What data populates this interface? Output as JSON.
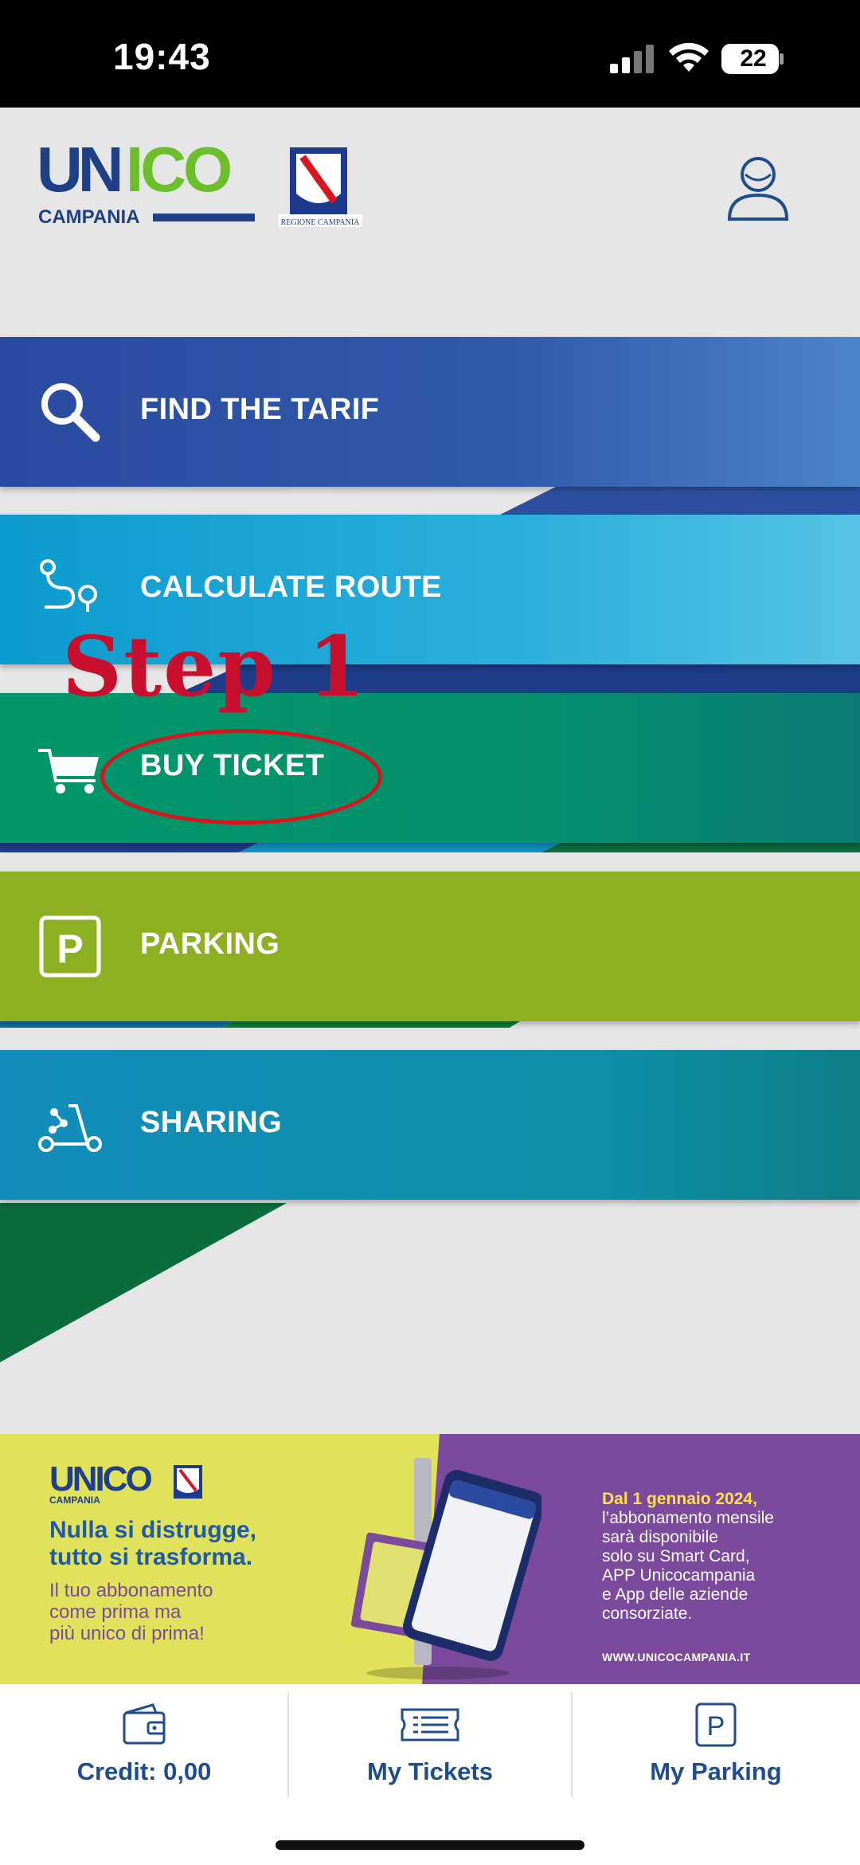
{
  "status_bar": {
    "time": "19:43",
    "battery": "22"
  },
  "header": {
    "logo_text": "UNICO",
    "logo_subtitle": "CAMPANIA",
    "region_caption": "REGIONE CAMPANIA",
    "profile_icon": "user-icon"
  },
  "menu": {
    "items": [
      {
        "label": "FIND THE TARIF",
        "icon": "search-icon"
      },
      {
        "label": "CALCULATE ROUTE",
        "icon": "route-icon"
      },
      {
        "label": "BUY TICKET",
        "icon": "cart-icon"
      },
      {
        "label": "PARKING",
        "icon": "parking-icon"
      },
      {
        "label": "SHARING",
        "icon": "scooter-icon"
      }
    ]
  },
  "annotation": {
    "step_text": "Step 1"
  },
  "banner": {
    "logo_text": "UNICO",
    "logo_subtitle": "CAMPANIA",
    "headline_1": "Nulla si distrugge,",
    "headline_2": "tutto si trasforma.",
    "sub_1": "Il tuo abbonamento",
    "sub_2": "come prima ma",
    "sub_3": "più unico di prima!",
    "right_date": "Dal 1 gennaio 2024,",
    "right_1": "l’abbonamento mensile",
    "right_2": "sarà disponibile",
    "right_3": "solo su Smart Card,",
    "right_4": "APP Unicocampania",
    "right_5": "e App delle aziende",
    "right_6": "consorziate.",
    "url": "WWW.UNICOCAMPANIA.IT"
  },
  "bottom_nav": {
    "items": [
      {
        "label": "Credit: 0,00",
        "icon": "wallet-icon"
      },
      {
        "label": "My Tickets",
        "icon": "tickets-icon"
      },
      {
        "label": "My Parking",
        "icon": "parking-icon"
      }
    ]
  },
  "colors": {
    "nav_text": "#1f4c8d",
    "find_tarif": "#2a4ba0",
    "calculate_route": "#0c9bce",
    "buy_ticket": "#01976a",
    "parking": "#8db022",
    "sharing": "#138cbb",
    "annotation_red": "#c8102e"
  }
}
